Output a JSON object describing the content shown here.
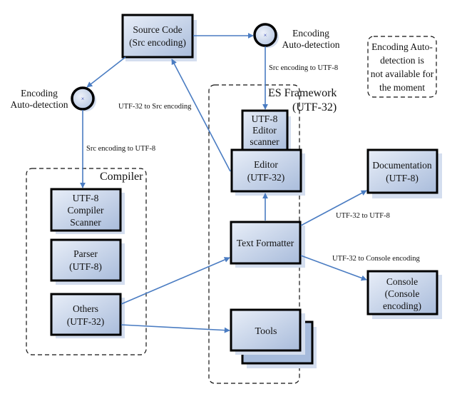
{
  "diagram": {
    "colors": {
      "box_fill_light": "#e6edf7",
      "box_fill_dark": "#adc0dd",
      "box_border": "#000000",
      "shadow": "#d4deef",
      "arrow": "#4a7cc2",
      "dashed": "#111111"
    },
    "containers": {
      "compiler": {
        "label": "Compiler"
      },
      "es_framework": {
        "label_line1": "ES Framework",
        "label_line2": "(UTF-32)"
      },
      "note": {
        "lines": [
          "Encoding Auto-",
          "detection is",
          "not available for",
          "the moment"
        ]
      }
    },
    "nodes": {
      "source_code": {
        "lines": [
          "Source Code",
          "(Src encoding)"
        ]
      },
      "compiler_scanner": {
        "lines": [
          "UTF-8",
          "Compiler",
          "Scanner"
        ]
      },
      "parser": {
        "lines": [
          "Parser",
          "(UTF-8)"
        ]
      },
      "others": {
        "lines": [
          "Others",
          "(UTF-32)"
        ]
      },
      "editor_scanner": {
        "lines": [
          "UTF-8",
          "Editor",
          "scanner"
        ]
      },
      "editor": {
        "lines": [
          "Editor",
          "(UTF-32)"
        ]
      },
      "text_formatter": {
        "lines": [
          "Text Formatter"
        ]
      },
      "tools": {
        "lines": [
          "Tools"
        ]
      },
      "documentation": {
        "lines": [
          "Documentation",
          "(UTF-8)"
        ]
      },
      "console": {
        "lines": [
          "Console",
          "(Console",
          "encoding)"
        ]
      }
    },
    "detectors": {
      "right": {
        "lines": [
          "Encoding",
          "Auto-detection"
        ]
      },
      "left": {
        "lines": [
          "Encoding",
          "Auto-detection"
        ]
      }
    },
    "edge_labels": {
      "src_to_utf8_right": "Src encoding to UTF-8",
      "src_to_utf8_left": "Src encoding to UTF-8",
      "utf32_to_src": "UTF-32 to Src encoding",
      "utf32_to_utf8": "UTF-32 to UTF-8",
      "utf32_to_console": "UTF-32 to Console encoding"
    }
  }
}
